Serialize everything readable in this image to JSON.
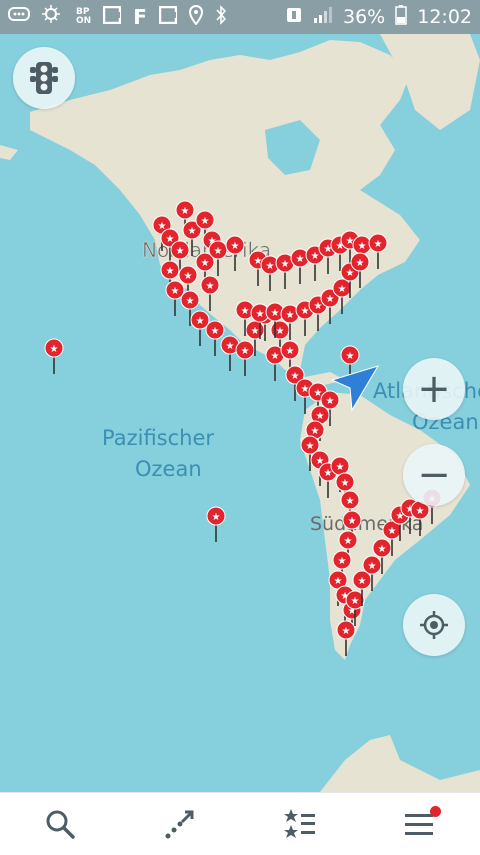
{
  "status_bar": {
    "battery": "36%",
    "time": "12:02",
    "left_icons": [
      "chat-icon",
      "weather-icon",
      "bp-on-icon",
      "app-e-icon",
      "app-f-icon",
      "app-e-icon",
      "location-icon",
      "bluetooth-icon",
      "signal-icon",
      "notification-icon",
      "cell-signal-icon"
    ],
    "bp_line1": "BP",
    "bp_line2": "ON",
    "letter_f": "F"
  },
  "map": {
    "labels": {
      "north_america": "Nordamerika",
      "pacific_line1": "Pazifischer",
      "pacific_line2": "Ozean",
      "atlantic_line1": "Atlantischer",
      "atlantic_line2": "Ozean",
      "south_america": "Südamerika"
    },
    "colors": {
      "water": "#86cfdc",
      "land": "#e7e3d3",
      "pin": "#e2242d",
      "accent": "#2f7fd7"
    }
  },
  "controls": {
    "traffic": "traffic-light-icon",
    "zoom_in": "+",
    "zoom_out": "−",
    "locate": "locate-icon"
  },
  "bottom_nav": {
    "items": [
      {
        "icon": "search-icon"
      },
      {
        "icon": "route-icon"
      },
      {
        "icon": "favorites-icon"
      },
      {
        "icon": "menu-icon",
        "badge": true
      }
    ]
  }
}
